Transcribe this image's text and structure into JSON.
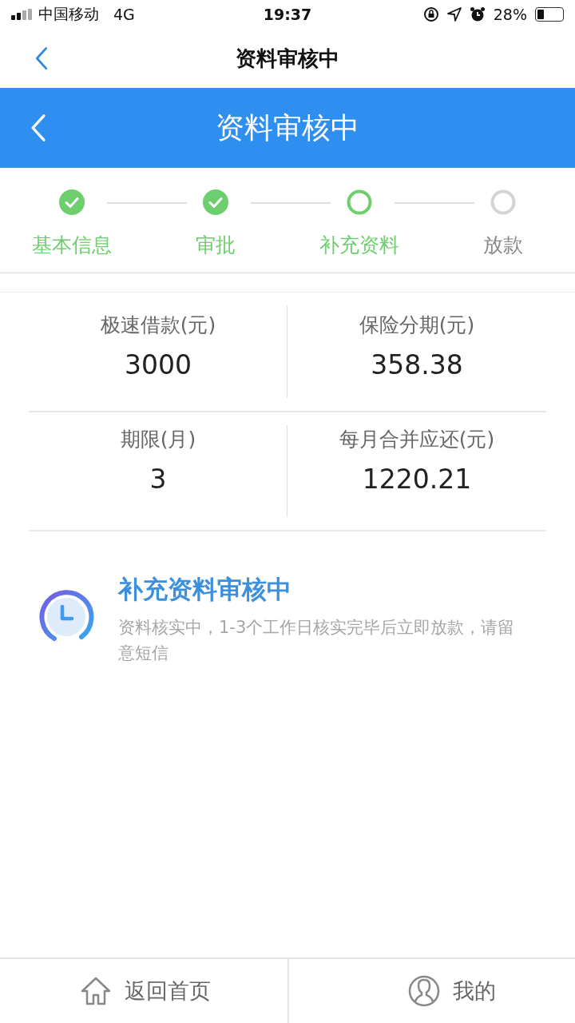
{
  "status_bar": {
    "carrier": "中国移动",
    "network": "4G",
    "time": "19:37",
    "battery": "28%"
  },
  "nav_bar": {
    "title": "资料审核中"
  },
  "header": {
    "title": "资料审核中"
  },
  "steps": [
    {
      "label": "基本信息",
      "kind": "done"
    },
    {
      "label": "审批",
      "kind": "done"
    },
    {
      "label": "补充资料",
      "kind": "current"
    },
    {
      "label": "放款",
      "kind": "pending"
    }
  ],
  "summary": [
    {
      "label": "极速借款(元)",
      "value": "3000"
    },
    {
      "label": "保险分期(元)",
      "value": "358.38"
    },
    {
      "label": "期限(月)",
      "value": "3"
    },
    {
      "label": "每月合并应还(元)",
      "value": "1220.21"
    }
  ],
  "notice": {
    "title": "补充资料审核中",
    "message": "资料核实中，1-3个工作日核实完毕后立即放款，请留意短信"
  },
  "tab_bar": [
    {
      "label": "返回首页",
      "kind": "home"
    },
    {
      "label": "我的",
      "kind": "profile"
    }
  ]
}
